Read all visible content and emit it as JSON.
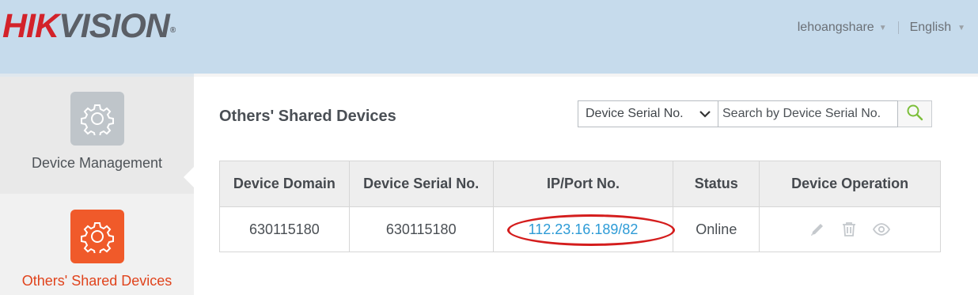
{
  "header": {
    "logo_part1": "HIK",
    "logo_part2": "VISION",
    "logo_mark": "®",
    "username": "lehoangshare",
    "language": "English"
  },
  "sidebar": {
    "items": [
      {
        "label": "Device Management",
        "icon": "gear-icon",
        "active": false
      },
      {
        "label": "Others' Shared Devices",
        "icon": "gear-icon",
        "active": true
      }
    ]
  },
  "main": {
    "title": "Others' Shared Devices",
    "search": {
      "filter_selected": "Device Serial No.",
      "placeholder": "Search by Device Serial No.",
      "button_icon": "search-icon"
    },
    "table": {
      "columns": [
        "Device Domain",
        "Device Serial No.",
        "IP/Port No.",
        "Status",
        "Device Operation"
      ],
      "rows": [
        {
          "domain": "630115180",
          "serial": "630115180",
          "ip_port": "112.23.16.189/82",
          "status": "Online",
          "operations": [
            "edit-icon",
            "delete-icon",
            "view-icon"
          ]
        }
      ]
    }
  },
  "colors": {
    "header_bg": "#c6dbec",
    "brand_red": "#d3222a",
    "active_orange": "#f05a2a",
    "link_blue": "#2d9bd6",
    "online_green": "#6ab82c",
    "annotation_red": "#d41d1d"
  }
}
